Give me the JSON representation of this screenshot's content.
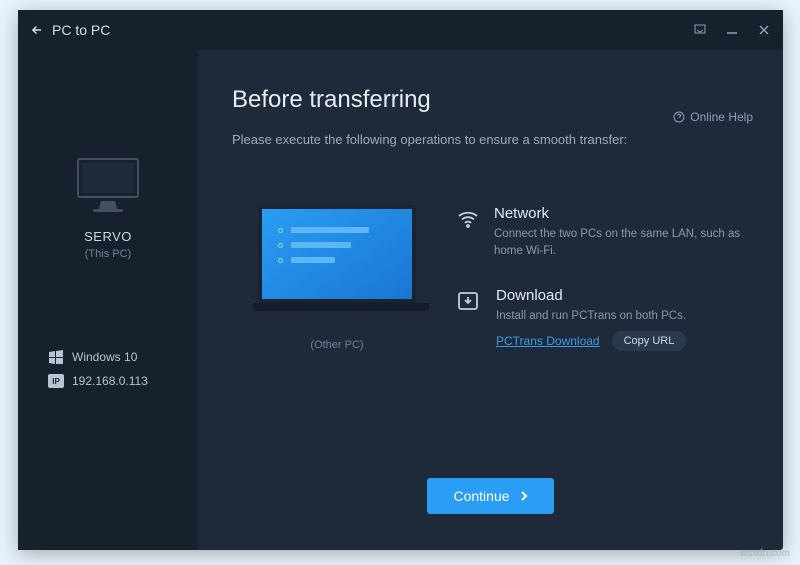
{
  "titlebar": {
    "title": "PC to PC"
  },
  "sidebar": {
    "pc_name": "SERVO",
    "pc_sub": "(This PC)",
    "os_label": "Windows 10",
    "ip_label": "192.168.0.113"
  },
  "main": {
    "title": "Before transferring",
    "subtitle": "Please execute the following operations to ensure a smooth transfer:",
    "help": "Online Help",
    "laptop_label": "(Other PC)",
    "network": {
      "title": "Network",
      "desc": "Connect the two PCs on the same LAN, such as home Wi-Fi."
    },
    "download": {
      "title": "Download",
      "desc": "Install and run PCTrans on both PCs.",
      "link": "PCTrans Download",
      "copy": "Copy URL"
    },
    "continue": "Continue"
  },
  "watermark": "wsxdn.com"
}
